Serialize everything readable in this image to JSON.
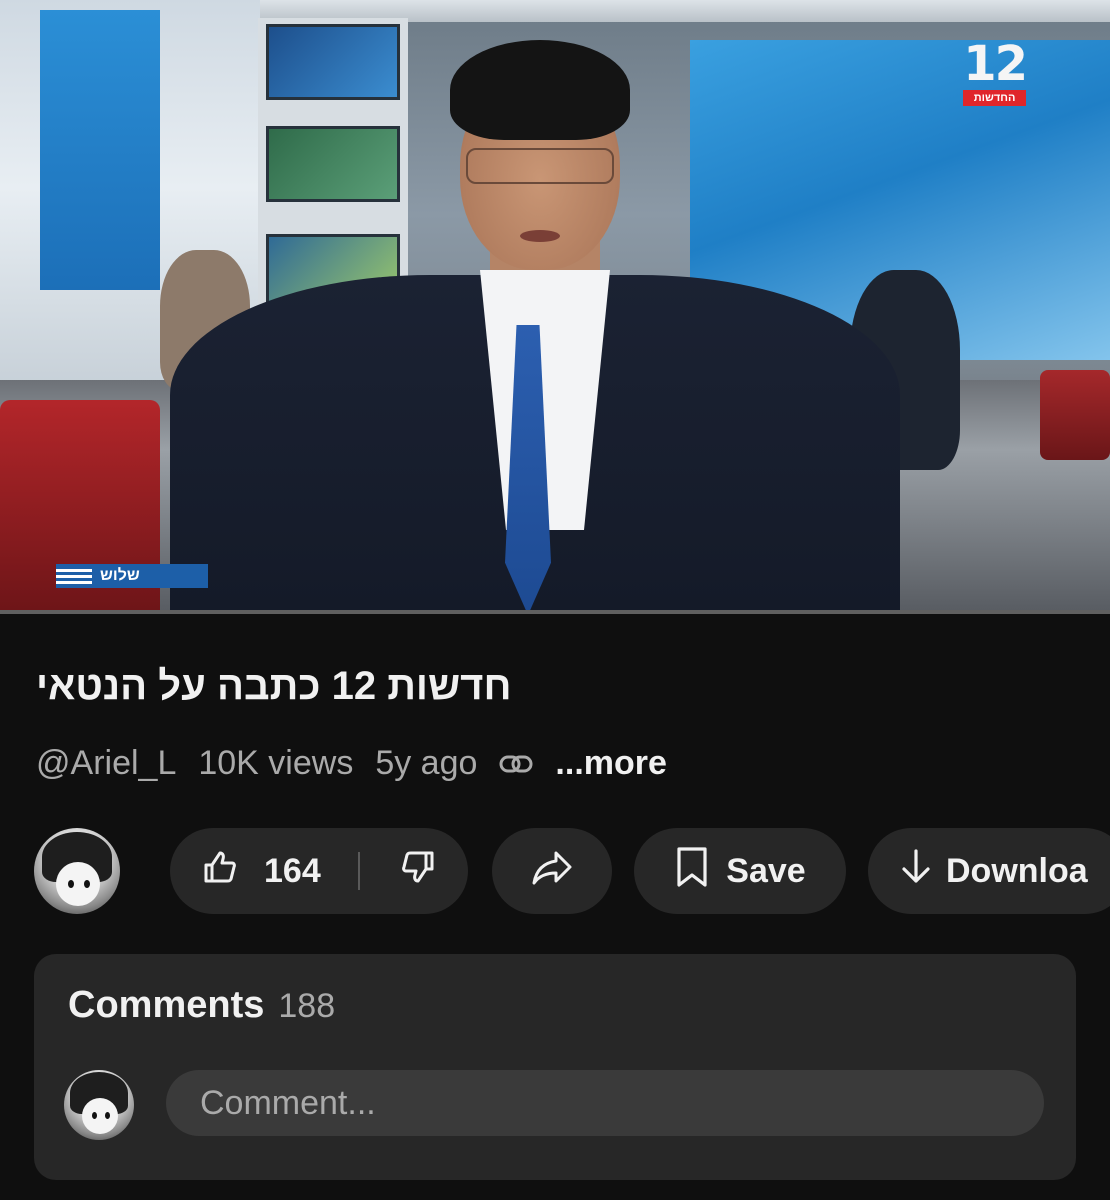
{
  "video": {
    "channel_logo_number": "12",
    "channel_logo_text": "החדשות",
    "lower_third_text": "שלוש",
    "progress_fraction": 0.0
  },
  "title": "חדשות 12 כתבה על הנטאי",
  "meta": {
    "channel": "@Ariel_L",
    "views": "10K views",
    "age": "5y ago",
    "link_icon": "link-icon",
    "more_label": "...more"
  },
  "actions": {
    "like_count": "164",
    "like_icon": "thumbs-up-icon",
    "dislike_icon": "thumbs-down-icon",
    "share_icon": "share-arrow-icon",
    "save_label": "Save",
    "save_icon": "bookmark-icon",
    "download_label": "Downloa",
    "download_icon": "download-arrow-icon"
  },
  "comments": {
    "label": "Comments",
    "count": "188",
    "input_placeholder": "Comment..."
  },
  "colors": {
    "background": "#0f0f0f",
    "pill": "#272727",
    "text_primary": "#f1f1f1",
    "text_secondary": "#aaaaaa",
    "logo_red": "#e0262b",
    "lower_third_blue": "#1d5fa8"
  }
}
